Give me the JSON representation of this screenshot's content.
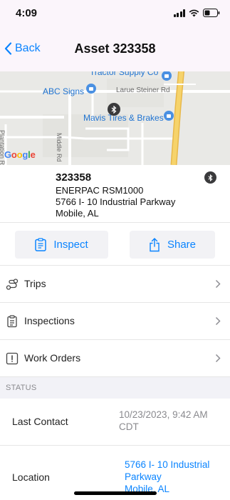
{
  "status_bar": {
    "time": "4:09"
  },
  "nav": {
    "back_label": "Back",
    "title": "Asset 323358"
  },
  "map": {
    "labels": {
      "tractor_supply": "Tractor Supply Co",
      "abc_signs": "ABC Signs",
      "larue_steiner": "Larue Steiner Rd",
      "mavis": "Mavis Tires & Brakes",
      "middle_rd": "Middle Rd",
      "left_road": "Plantation Rd"
    },
    "google_logo": "Google"
  },
  "asset": {
    "id": "323358",
    "model": "ENERPAC RSM1000",
    "address_line1": "5766 I- 10 Industrial Parkway",
    "address_line2": "Mobile, AL"
  },
  "actions": {
    "inspect_label": "Inspect",
    "share_label": "Share"
  },
  "menu": {
    "items": [
      {
        "label": "Trips",
        "icon": "route-icon"
      },
      {
        "label": "Inspections",
        "icon": "clipboard-icon"
      },
      {
        "label": "Work Orders",
        "icon": "alert-square-icon"
      }
    ]
  },
  "status_section": {
    "header": "STATUS",
    "last_contact_label": "Last Contact",
    "last_contact_line1": "10/23/2023, 9:42 AM",
    "last_contact_line2": "CDT",
    "location_label": "Location",
    "location_line1": "5766 I- 10 Industrial",
    "location_line2": "Parkway",
    "location_line3": "Mobile, AL"
  },
  "colors": {
    "accent": "#0a84ff",
    "nav_bg": "#fbf5fb",
    "highway": "#f2c94c"
  }
}
